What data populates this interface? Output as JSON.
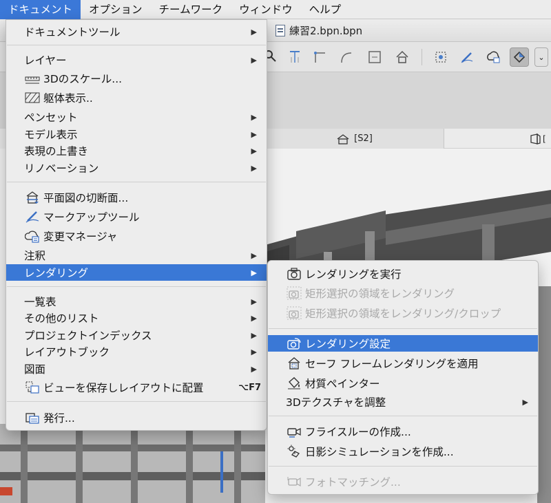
{
  "menubar": {
    "items": [
      "ドキュメント",
      "オプション",
      "チームワーク",
      "ウィンドウ",
      "ヘルプ"
    ]
  },
  "window": {
    "title": "練習2.bpn.bpn",
    "view_tab_label": "[S2]",
    "view_tab2_label": "["
  },
  "document_menu": {
    "documenttools": "ドキュメントツール",
    "layers": "レイヤー",
    "scale3d": "3Dのスケール...",
    "structure_display": "躯体表示..",
    "pen_sets": "ペンセット",
    "model_display": "モデル表示",
    "graphic_overrides": "表現の上書き",
    "renovation": "リノベーション",
    "floor_plan_cut": "平面図の切断面...",
    "markup_tools": "マークアップツール",
    "change_manager": "変更マネージャ",
    "annotation": "注釈",
    "rendering": "レンダリング",
    "schedules": "一覧表",
    "other_lists": "その他のリスト",
    "project_indexes": "プロジェクトインデックス",
    "layout_book": "レイアウトブック",
    "drawings": "図面",
    "save_view_place": "ビューを保存しレイアウトに配置",
    "save_view_shortcut": "⌥F7",
    "publish": "発行..."
  },
  "rendering_submenu": {
    "render": "レンダリングを実行",
    "render_area": "矩形選択の領域をレンダリング",
    "render_area_crop": "矩形選択の領域をレンダリング/クロップ",
    "render_settings": "レンダリング設定",
    "safe_frame": "セーフ フレームレンダリングを適用",
    "material_painter": "材質ペインター",
    "adjust_3d_textures": "3Dテクスチャを調整",
    "fly_through": "フライスルーの作成...",
    "sun_study": "日影シミュレーションを作成...",
    "photo_matching": "フォトマッチング..."
  },
  "colors": {
    "highlight": "#3a78d6",
    "disabled_text": "#a9a9a9"
  }
}
